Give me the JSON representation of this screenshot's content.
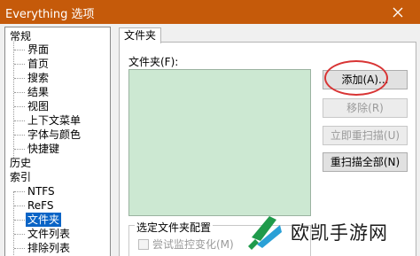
{
  "window": {
    "title": "Everything 选项",
    "accent": "#c55a0a"
  },
  "tree": {
    "nodes": [
      {
        "label": "常规"
      },
      {
        "label": "界面"
      },
      {
        "label": "首页"
      },
      {
        "label": "搜索"
      },
      {
        "label": "结果"
      },
      {
        "label": "视图"
      },
      {
        "label": "上下文菜单"
      },
      {
        "label": "字体与颜色"
      },
      {
        "label": "快捷键"
      },
      {
        "label": "历史"
      },
      {
        "label": "索引"
      },
      {
        "label": "NTFS"
      },
      {
        "label": "ReFS"
      },
      {
        "label": "文件夹"
      },
      {
        "label": "文件列表"
      },
      {
        "label": "排除列表"
      }
    ],
    "selected": "文件夹",
    "selection_color": "#0a64c6"
  },
  "tab": {
    "label": "文件夹"
  },
  "folders": {
    "label": "文件夹(F):",
    "list_color": "#cce8d2"
  },
  "buttons": {
    "add": "添加(A)...",
    "remove": "移除(R)",
    "rescan_now": "立即重扫描(U)",
    "rescan_all": "重扫描全部(N)"
  },
  "config_group": {
    "title": "选定文件夹配置",
    "monitor_changes": "尝试监控变化(M)"
  },
  "watermark": {
    "text": "欧凯手游网"
  }
}
